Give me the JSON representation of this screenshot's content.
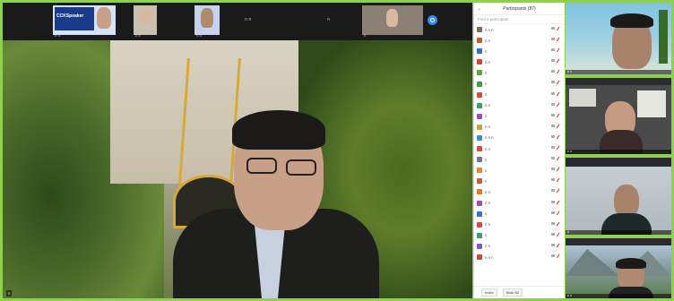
{
  "meeting": {
    "thumbnails": [
      {
        "label": "ก ก",
        "caption": "CCKSpeaker",
        "kind": "slide"
      },
      {
        "label": "ก ก",
        "kind": "person"
      },
      {
        "label": "ก ก",
        "kind": "person"
      },
      {
        "label": "ก ก",
        "kind": "none"
      },
      {
        "label": "ก",
        "kind": "none"
      },
      {
        "label": "ก",
        "kind": "person"
      }
    ],
    "speaker_name": "ก"
  },
  "participants_panel": {
    "title": "Participants (87)",
    "search_placeholder": "Find a participant",
    "participants": [
      {
        "name": "ก ก ก",
        "color": "#7a6a58"
      },
      {
        "name": "ก ก",
        "color": "#c85a30"
      },
      {
        "name": "ก",
        "color": "#2e6fd1"
      },
      {
        "name": "ก ก",
        "color": "#d0453a"
      },
      {
        "name": "ก",
        "color": "#5aa53a"
      },
      {
        "name": "ก",
        "color": "#3a9e4a"
      },
      {
        "name": "ก",
        "color": "#d24a3a"
      },
      {
        "name": "ก ก",
        "color": "#3a9e6a"
      },
      {
        "name": "ก",
        "color": "#9a4ac8"
      },
      {
        "name": "ก ก",
        "color": "#c8a23a"
      },
      {
        "name": "ก ก ก",
        "color": "#3a8ed1"
      },
      {
        "name": "ก ก",
        "color": "#d24a3a"
      },
      {
        "name": "ก",
        "color": "#6a7a8a"
      },
      {
        "name": "ก",
        "color": "#e08a3a"
      },
      {
        "name": "ก",
        "color": "#c85a3a"
      },
      {
        "name": "ก ก",
        "color": "#e07a2a"
      },
      {
        "name": "ก ก",
        "color": "#9a4ac8"
      },
      {
        "name": "ก",
        "color": "#3a6ed1"
      },
      {
        "name": "ก ก",
        "color": "#d04a4a"
      },
      {
        "name": "ก",
        "color": "#3aa06a"
      },
      {
        "name": "ก ก",
        "color": "#7a5ac8"
      },
      {
        "name": "ก ก ก",
        "color": "#c84a3a"
      }
    ],
    "footer_buttons": [
      "Invite",
      "Mute All"
    ]
  },
  "gallery": {
    "tiles": [
      {
        "name": "ก ก",
        "bg": "#6fb3c8"
      },
      {
        "name": "ก ก",
        "bg": "#4a4a4a"
      },
      {
        "name": "ก",
        "bg": "#b9c2c8"
      },
      {
        "name": "ก ก",
        "bg": "#6f8a6a"
      }
    ]
  }
}
